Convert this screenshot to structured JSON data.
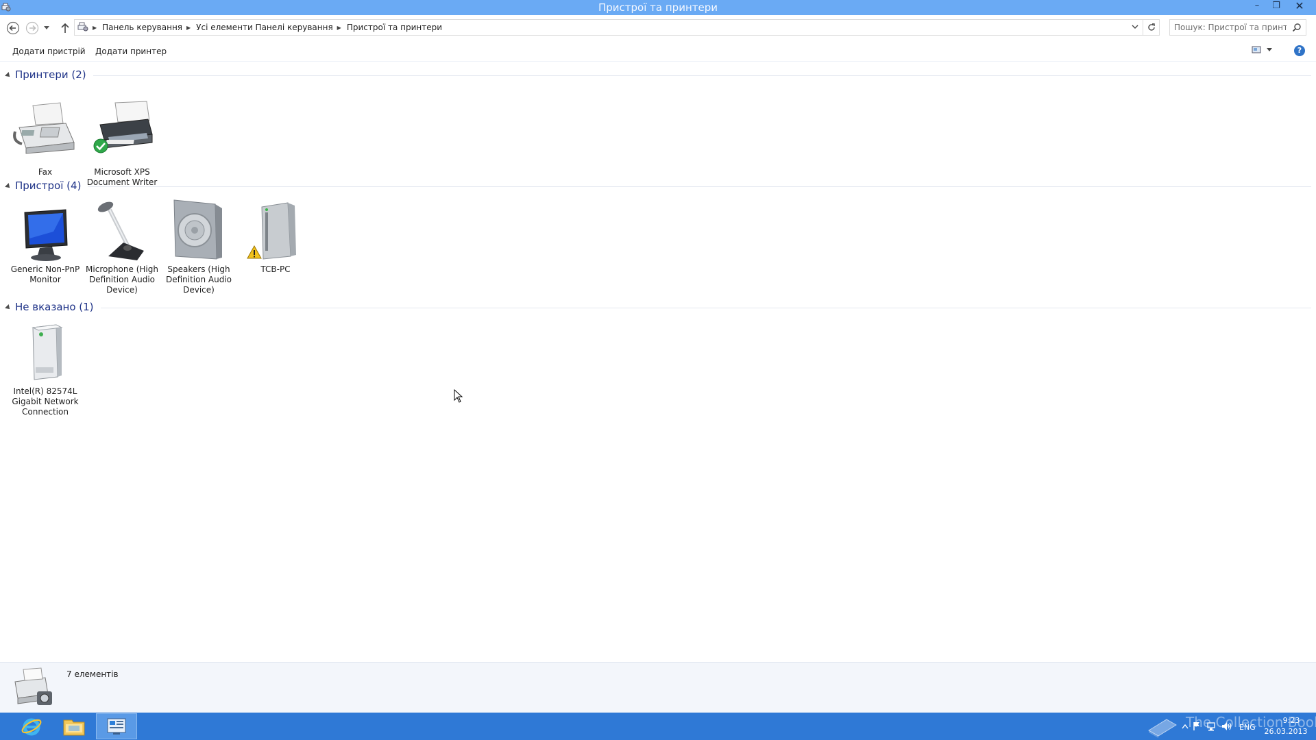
{
  "window": {
    "title": "Пристрої та принтери",
    "minimize_glyph": "–",
    "restore_glyph": "❐",
    "close_glyph": "✕"
  },
  "address_bar": {
    "breadcrumbs": [
      "Панель керування",
      "Усі елементи Панелі керування",
      "Пристрої та принтери"
    ],
    "search_placeholder": "Пошук: Пристрої та принтери"
  },
  "commands": {
    "add_device": "Додати пристрій",
    "add_printer": "Додати принтер",
    "help_glyph": "?"
  },
  "groups": [
    {
      "label": "Принтери (2)",
      "items": [
        {
          "label": "Fax",
          "icon": "fax-icon"
        },
        {
          "label": "Microsoft XPS Document Writer",
          "icon": "printer-icon",
          "badge": "default-check"
        }
      ]
    },
    {
      "label": "Пристрої (4)",
      "items": [
        {
          "label": "Generic Non-PnP Monitor",
          "icon": "monitor-icon"
        },
        {
          "label": "Microphone (High Definition Audio Device)",
          "icon": "microphone-icon"
        },
        {
          "label": "Speakers (High Definition Audio Device)",
          "icon": "speaker-icon"
        },
        {
          "label": "TCB-PC",
          "icon": "computer-icon",
          "badge": "warning"
        }
      ]
    },
    {
      "label": "Не вказано (1)",
      "items": [
        {
          "label": "Intel(R) 82574L Gigabit Network Connection",
          "icon": "network-adapter-icon"
        }
      ]
    }
  ],
  "details": {
    "count": "7 елементів"
  },
  "taskbar": {
    "apps": [
      "internet-explorer-icon",
      "file-explorer-icon",
      "control-panel-icon"
    ],
    "active_app": "control-panel-icon",
    "tray": {
      "lang": "ENG",
      "time": "9:23",
      "date": "26.03.2013"
    },
    "watermark": "The Collection Book"
  },
  "colors": {
    "titlebar": "#6aaaf4",
    "taskbar": "#2f79d6",
    "group_header": "#1e3287",
    "details_bg": "#f3f6fb"
  }
}
